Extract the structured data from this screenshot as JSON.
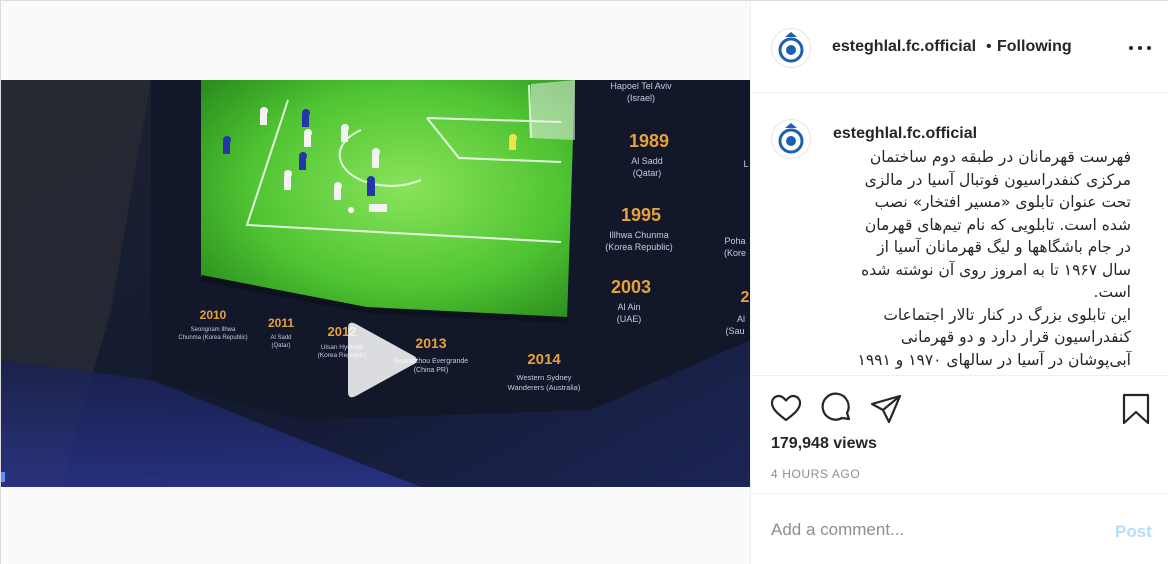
{
  "post": {
    "username": "esteghlal.fc.official",
    "separator": "•",
    "follow_status": "Following",
    "more_icon": "more-horizontal-icon",
    "caption_lines": [
      "فهرست قهرمانان در طبقه دوم ساختمان",
      "مرکزی کنفدراسیون فوتبال آسیا در مالزی",
      "تحت عنوان تابلوی «مسیر افتخار» نصب",
      "شده است. تابلویی که نام تیم‌های قهرمان",
      "در جام باشگاهها و لیگ قهرمانان آسیا از",
      "سال ۱۹۶۷ تا به امروز روی آن نوشته شده",
      "است.",
      "این تابلوی بزرگ در کنار تالار اجتماعات",
      "کنفدراسیون قرار دارد و دو قهرمانی",
      "آبی‌پوشان در آسیا در سالهای ۱۹۷۰ و ۱۹۹۱"
    ],
    "views": "179,948 views",
    "timestamp": "4 HOURS AGO",
    "actions": {
      "like_icon": "heart-icon",
      "comment_icon": "comment-icon",
      "share_icon": "paper-plane-icon",
      "save_icon": "bookmark-icon"
    },
    "add_comment": {
      "placeholder": "Add a comment...",
      "post_label": "Post"
    }
  },
  "video": {
    "play_icon": "play-icon",
    "board_entries": [
      {
        "year": "2010",
        "club": "Seongnam Ilhwa",
        "country": "Chunma (Korea Republic)"
      },
      {
        "year": "2011",
        "club": "Al Sadd",
        "country": "(Qatar)"
      },
      {
        "year": "2012",
        "club": "Ulsan Hyundai",
        "country": "(Korea Republic)"
      },
      {
        "year": "2013",
        "club": "Guangzhou Evergrande",
        "country": "(China PR)"
      },
      {
        "year": "2014",
        "club": "Western Sydney",
        "country": "Wanderers (Australia)"
      },
      {
        "year": "",
        "club": "Hapoel Tel Aviv",
        "country": "(Israel)"
      },
      {
        "year": "1989",
        "club": "Al Sadd",
        "country": "(Qatar)"
      },
      {
        "year": "1995",
        "club": "Illhwa Chunma",
        "country": "(Korea Republic)"
      },
      {
        "year": "2003",
        "club": "Al Ain",
        "country": "(UAE)"
      }
    ],
    "edge_fragments": [
      "L",
      "Poha",
      "(Kore",
      "2",
      "Al",
      "(Sau"
    ]
  },
  "colors": {
    "accent": "#0095f6",
    "post_disabled": "#b2dffc",
    "muted": "#8e8e8e",
    "text": "#262626",
    "pitch": "#5bcf3a",
    "board": "#13182a",
    "board_year": "#e8a03a"
  }
}
